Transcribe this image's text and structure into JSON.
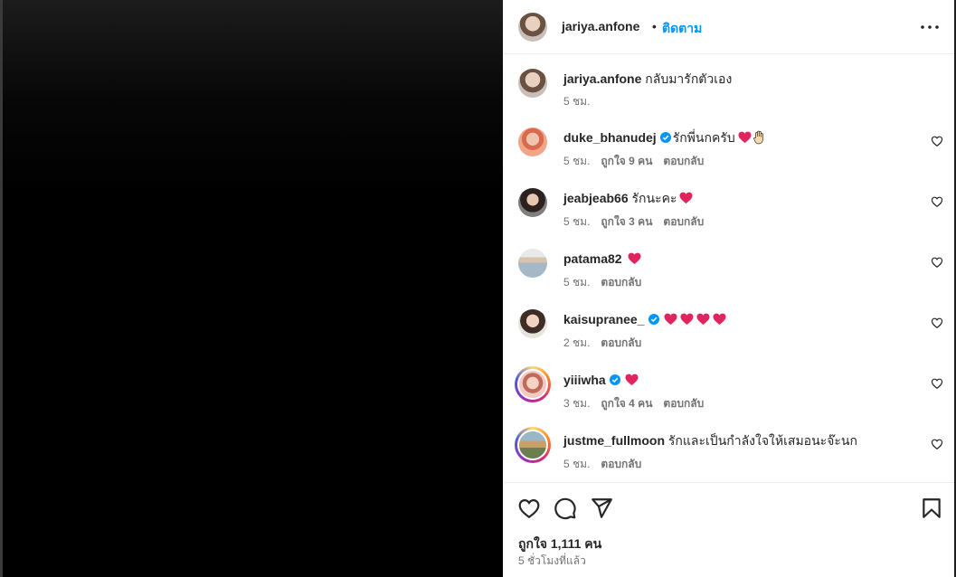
{
  "post": {
    "author": "jariya.anfone",
    "separator": "•",
    "follow_label": "ติดตาม",
    "caption": {
      "username": "jariya.anfone",
      "text": "กลับมารักตัวเอง",
      "time": "5 ชม."
    }
  },
  "comments": [
    {
      "username": "duke_bhanudej",
      "verified": true,
      "text": "รักพี่นกครับ",
      "emoji": [
        "red-heart",
        "raised-hand"
      ],
      "time": "5 ชม.",
      "likes": "ถูกใจ 9 คน",
      "reply": "ตอบกลับ"
    },
    {
      "username": "jeabjeab66",
      "verified": false,
      "text": "รักนะคะ",
      "emoji": [
        "red-heart"
      ],
      "time": "5 ชม.",
      "likes": "ถูกใจ 3 คน",
      "reply": "ตอบกลับ"
    },
    {
      "username": "patama82",
      "verified": false,
      "text": "",
      "emoji": [
        "red-heart"
      ],
      "time": "5 ชม.",
      "likes": "",
      "reply": "ตอบกลับ"
    },
    {
      "username": "kaisupranee_",
      "verified": true,
      "text": "",
      "emoji": [
        "red-heart",
        "red-heart",
        "red-heart",
        "red-heart"
      ],
      "time": "2 ชม.",
      "likes": "",
      "reply": "ตอบกลับ"
    },
    {
      "username": "yiiiwha",
      "verified": true,
      "text": "",
      "emoji": [
        "red-heart"
      ],
      "time": "3 ชม.",
      "likes": "ถูกใจ 4 คน",
      "reply": "ตอบกลับ"
    },
    {
      "username": "justme_fullmoon",
      "verified": false,
      "text": "รักและเป็นกำลังใจให้เสมอนะจ๊ะนก",
      "emoji": [],
      "time": "5 ชม.",
      "likes": "",
      "reply": "ตอบกลับ"
    }
  ],
  "footer": {
    "likes": "ถูกใจ 1,111 คน",
    "time_ago": "5 ชั่วโมงที่แล้ว"
  },
  "colors": {
    "link_blue": "#0095f6",
    "verified_blue": "#0095f6",
    "heart_red": "#e0245e",
    "meta_gray": "#737373"
  },
  "icons": [
    "more-options-icon",
    "like-icon",
    "comment-icon",
    "share-icon",
    "save-icon",
    "verified-badge-icon",
    "red-heart-emoji",
    "raised-hand-emoji"
  ]
}
